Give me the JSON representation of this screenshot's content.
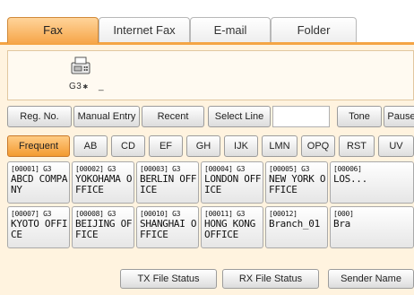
{
  "tabs": [
    {
      "label": "Fax"
    },
    {
      "label": "Internet Fax"
    },
    {
      "label": "E-mail"
    },
    {
      "label": "Folder"
    }
  ],
  "destination": {
    "line": "G3",
    "cursor": "_"
  },
  "toolbar": {
    "reg_no": "Reg. No.",
    "manual_entry": "Manual Entry",
    "recent": "Recent",
    "select_line": "Select Line",
    "tone": "Tone",
    "pause": "Pause"
  },
  "index_tabs": [
    "Frequent",
    "AB",
    "CD",
    "EF",
    "GH",
    "IJK",
    "LMN",
    "OPQ",
    "RST",
    "UV"
  ],
  "entries": [
    {
      "id": "[00001] G3",
      "name": "ABCD COMPANY"
    },
    {
      "id": "[00002] G3",
      "name": "YOKOHAMA OFFICE"
    },
    {
      "id": "[00003] G3",
      "name": "BERLIN OFFICE"
    },
    {
      "id": "[00004] G3",
      "name": "LONDON OFFICE"
    },
    {
      "id": "[00005] G3",
      "name": "NEW YORK OFFICE"
    },
    {
      "id": "[00006]",
      "name": "LOS..."
    },
    {
      "id": "[00007] G3",
      "name": "KYOTO OFFICE"
    },
    {
      "id": "[00008] G3",
      "name": "BEIJING OFFICE"
    },
    {
      "id": "[00010] G3",
      "name": "SHANGHAI OFFICE"
    },
    {
      "id": "[00011] G3",
      "name": "HONG KONG OFFICE"
    },
    {
      "id": "[00012]",
      "name": "Branch_01"
    },
    {
      "id": "[000]",
      "name": "Bra"
    }
  ],
  "bottom_buttons": {
    "tx_file_status": "TX File Status",
    "rx_file_status": "RX File Status",
    "sender_name": "Sender Name"
  },
  "colors": {
    "active_tab": "#f6a64a",
    "panel_bg": "#fff3df",
    "accent": "#f4a444"
  }
}
